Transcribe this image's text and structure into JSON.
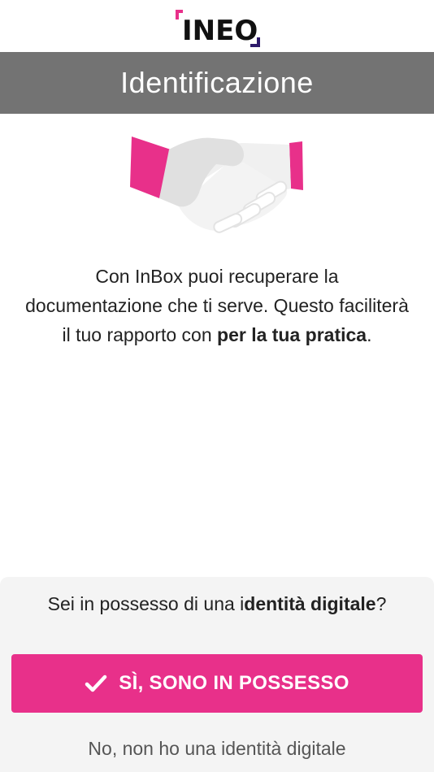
{
  "logo": {
    "text": "INEO",
    "icon": "ineo-logo"
  },
  "header": {
    "title": "Identificazione"
  },
  "illustration": {
    "icon": "handshake-icon"
  },
  "intro": {
    "part1": "Con InBox puoi recuperare la documentazione che ti serve. Questo faciliterà il tuo rapporto con ",
    "bold": "per la tua pratica",
    "part2": "."
  },
  "question": {
    "prefix": "Sei in possesso di una i",
    "bold": "dentità digitale",
    "suffix": "?"
  },
  "actions": {
    "yes_label": "SÌ, SONO IN POSSESSO",
    "yes_icon": "check-icon",
    "no_label": "No, non ho una identità digitale"
  },
  "colors": {
    "accent": "#e8308a",
    "header_bg": "#737373",
    "logo_corner_secondary": "#2e1a6b"
  }
}
